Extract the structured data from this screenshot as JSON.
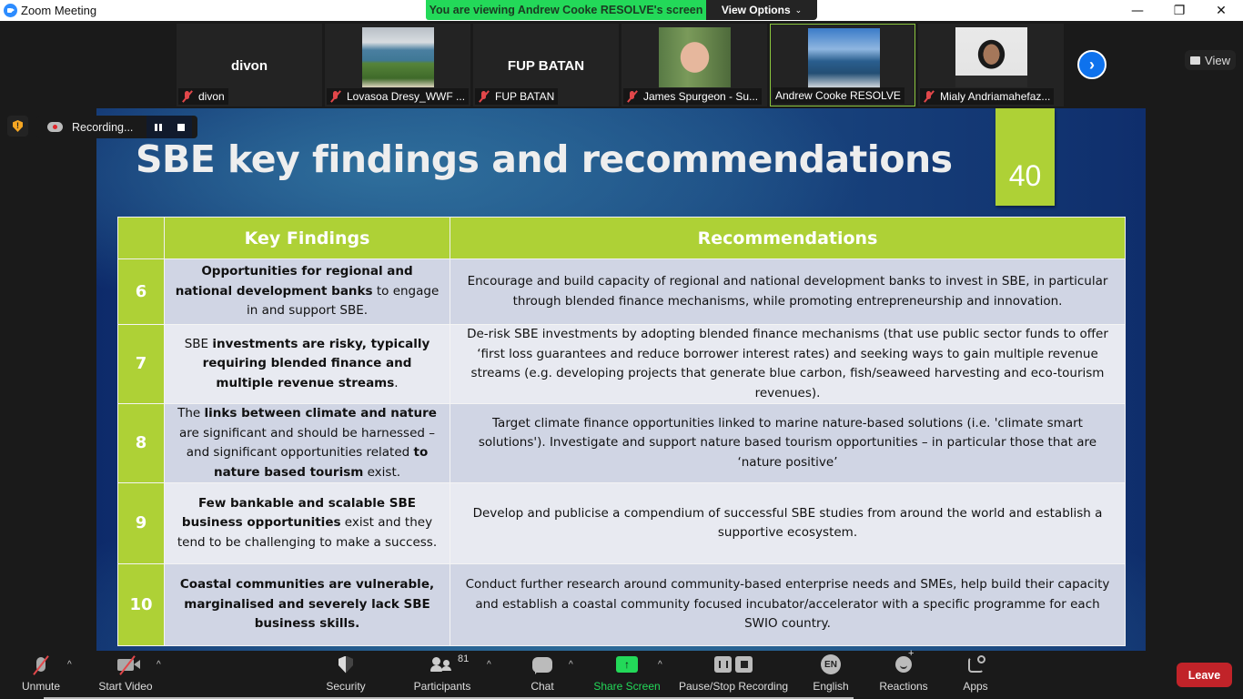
{
  "window": {
    "title": "Zoom Meeting",
    "controls": {
      "minimize": "—",
      "restore": "❐",
      "close": "✕"
    }
  },
  "banner": {
    "viewing_text": "You are viewing Andrew Cooke RESOLVE's screen",
    "view_options_label": "View Options",
    "view_options_icon": "chevron-down-icon"
  },
  "gallery": {
    "view_label": "View",
    "next_icon": "chevron-right-icon",
    "tiles": [
      {
        "display": "divon",
        "name": "divon",
        "muted": true,
        "has_photo": false
      },
      {
        "display": "",
        "name": "Lovasoa Dresy_WWF ...",
        "muted": true,
        "has_photo": true
      },
      {
        "display": "FUP BATAN",
        "name": "FUP BATAN",
        "muted": true,
        "has_photo": false
      },
      {
        "display": "",
        "name": "James Spurgeon - Su...",
        "muted": true,
        "has_photo": true
      },
      {
        "display": "",
        "name": "Andrew Cooke RESOLVE",
        "muted": false,
        "has_photo": true,
        "active_speaker": true
      },
      {
        "display": "",
        "name": "Mialy Andriamahefaz...",
        "muted": true,
        "has_photo": true
      }
    ]
  },
  "recording": {
    "label": "Recording...",
    "security_badge": "!"
  },
  "slide": {
    "title": "SBE key findings and recommendations",
    "number": "40",
    "accent_color": "#aed136",
    "headers": {
      "num": "",
      "findings": "Key Findings",
      "recommendations": "Recommendations"
    },
    "rows": [
      {
        "num": "6",
        "finding_parts": [
          {
            "text": "Opportunities for regional and national development banks",
            "bold": true
          },
          {
            "text": " to engage in and support SBE.",
            "bold": false
          }
        ],
        "recommendation": "Encourage and build capacity of regional and national development banks to invest in SBE, in particular through blended finance mechanisms, while promoting entrepreneurship and innovation."
      },
      {
        "num": "7",
        "finding_parts": [
          {
            "text": "SBE ",
            "bold": false
          },
          {
            "text": "investments are risky, typically requiring blended finance and multiple revenue streams",
            "bold": true
          },
          {
            "text": ".",
            "bold": false
          }
        ],
        "recommendation": "De-risk SBE investments by adopting blended finance mechanisms (that use public sector funds to offer ‘first loss guarantees and reduce borrower interest rates) and seeking ways to gain multiple revenue streams (e.g. developing projects that generate blue carbon, fish/seaweed harvesting and eco-tourism revenues)."
      },
      {
        "num": "8",
        "finding_parts": [
          {
            "text": "The ",
            "bold": false
          },
          {
            "text": "links between climate and nature",
            "bold": true
          },
          {
            "text": " are significant and should be harnessed – and significant opportunities related ",
            "bold": false
          },
          {
            "text": "to nature based tourism",
            "bold": true
          },
          {
            "text": " exist.",
            "bold": false
          }
        ],
        "recommendation": "Target climate finance opportunities linked to marine nature-based solutions (i.e. 'climate smart solutions'). Investigate and support nature based tourism opportunities – in particular those that are ‘nature positive’"
      },
      {
        "num": "9",
        "finding_parts": [
          {
            "text": "Few bankable and scalable SBE business opportunities",
            "bold": true
          },
          {
            "text": " exist and they tend to be challenging to make a success.",
            "bold": false
          }
        ],
        "recommendation": "Develop and publicise a compendium of successful SBE studies from around the world and establish a supportive ecosystem."
      },
      {
        "num": "10",
        "finding_parts": [
          {
            "text": "Coastal communities are vulnerable, marginalised and severely lack SBE business skills.",
            "bold": true
          }
        ],
        "recommendation": "Conduct further research around community-based enterprise needs and SMEs, help build their capacity and establish a coastal community focused incubator/accelerator with a specific programme for each SWIO country."
      }
    ]
  },
  "toolbar": {
    "unmute": "Unmute",
    "start_video": "Start Video",
    "security": "Security",
    "participants": "Participants",
    "participants_count": "81",
    "chat": "Chat",
    "share_screen": "Share Screen",
    "share_arrow": "↑",
    "pause_stop_recording": "Pause/Stop Recording",
    "language": "English",
    "language_badge": "EN",
    "reactions": "Reactions",
    "apps": "Apps",
    "leave": "Leave",
    "caret": "^",
    "share_color": "#23d959",
    "leave_color": "#c12329"
  }
}
